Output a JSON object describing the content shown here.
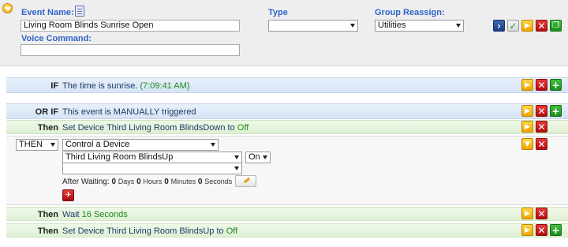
{
  "header": {
    "event_name_label": "Event Name:",
    "event_name_value": "Living Room Blinds Sunrise Open",
    "voice_command_label": "Voice Command:",
    "voice_command_value": "",
    "type_label": "Type",
    "type_value": "",
    "group_label": "Group Reassign:",
    "group_value": "Utilities"
  },
  "conditions": [
    {
      "keyword": "IF",
      "text": "The time is sunrise.",
      "extra": "(7:09:41 AM)"
    },
    {
      "keyword": "OR IF",
      "text": "This event is MANUALLY triggered"
    }
  ],
  "actions": {
    "row1": {
      "keyword": "Then",
      "prefix": "Set Device",
      "device": "Third Living Room BlindsDown",
      "to_label": "to",
      "value": "Off"
    },
    "editor": {
      "keyword_select": "THEN",
      "action_select": "Control a Device",
      "device_select": "Third Living Room BlindsUp",
      "state_select": "On",
      "second_select": "",
      "after_waiting_label": "After Waiting:",
      "days": "0",
      "days_label": "Days",
      "hours": "0",
      "hours_label": "Hours",
      "minutes": "0",
      "minutes_label": "Minutes",
      "seconds": "0",
      "seconds_label": "Seconds"
    },
    "row3": {
      "keyword": "Then",
      "prefix": "Wait",
      "value": "16 Seconds"
    },
    "row4": {
      "keyword": "Then",
      "prefix": "Set Device",
      "device": "Third Living Room BlindsUp",
      "to_label": "to",
      "value": "Off"
    }
  },
  "colors": {
    "accent_blue": "#2e64c8",
    "green_value": "#1a8a1a",
    "row_blue": "#d6e4f5",
    "row_green": "#dff0d4"
  }
}
